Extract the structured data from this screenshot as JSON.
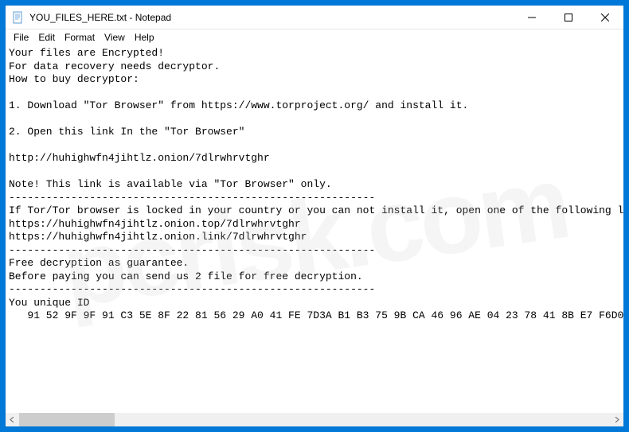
{
  "titlebar": {
    "title": "YOU_FILES_HERE.txt - Notepad"
  },
  "menubar": {
    "items": [
      "File",
      "Edit",
      "Format",
      "View",
      "Help"
    ]
  },
  "content": {
    "lines": [
      "Your files are Encrypted!",
      "For data recovery needs decryptor.",
      "How to buy decryptor:",
      "",
      "1. Download \"Tor Browser\" from https://www.torproject.org/ and install it.",
      "",
      "2. Open this link In the \"Tor Browser\"",
      "",
      "http://huhighwfn4jihtlz.onion/7dlrwhrvtghr",
      "",
      "Note! This link is available via \"Tor Browser\" only.",
      "-----------------------------------------------------------",
      "If Tor/Tor browser is locked in your country or you can not install it, open one of the following l",
      "https://huhighwfn4jihtlz.onion.top/7dlrwhrvtghr",
      "https://huhighwfn4jihtlz.onion.link/7dlrwhrvtghr",
      "-----------------------------------------------------------",
      "Free decryption as guarantee.",
      "Before paying you can send us 2 file for free decryption.",
      "-----------------------------------------------------------",
      "You unique ID",
      "   91 52 9F 9F 91 C3 5E 8F 22 81 56 29 A0 41 FE 7D3A B1 B3 75 9B CA 46 96 AE 04 23 78 41 8B E7 F6D0"
    ]
  },
  "watermark": "pcrisk.com"
}
